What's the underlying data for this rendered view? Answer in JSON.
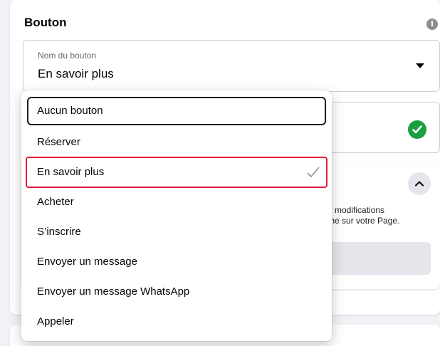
{
  "section": {
    "title": "Bouton",
    "info_icon": "info-icon"
  },
  "field": {
    "label": "Nom du bouton",
    "value": "En savoir plus"
  },
  "background_card": {
    "description_line1": "es modifications",
    "description_line2": "gine sur votre Page."
  },
  "dropdown": {
    "options": [
      {
        "label": "Aucun bouton",
        "state": "focused"
      },
      {
        "label": "Réserver",
        "state": ""
      },
      {
        "label": "En savoir plus",
        "state": "selected"
      },
      {
        "label": "Acheter",
        "state": ""
      },
      {
        "label": "S’inscrire",
        "state": ""
      },
      {
        "label": "Envoyer un message",
        "state": ""
      },
      {
        "label": "Envoyer un message WhatsApp",
        "state": ""
      },
      {
        "label": "Appeler",
        "state": ""
      }
    ]
  },
  "colors": {
    "success": "#1a9e3f",
    "highlight_border": "#e41e3f",
    "accent": "#e7a33e"
  }
}
